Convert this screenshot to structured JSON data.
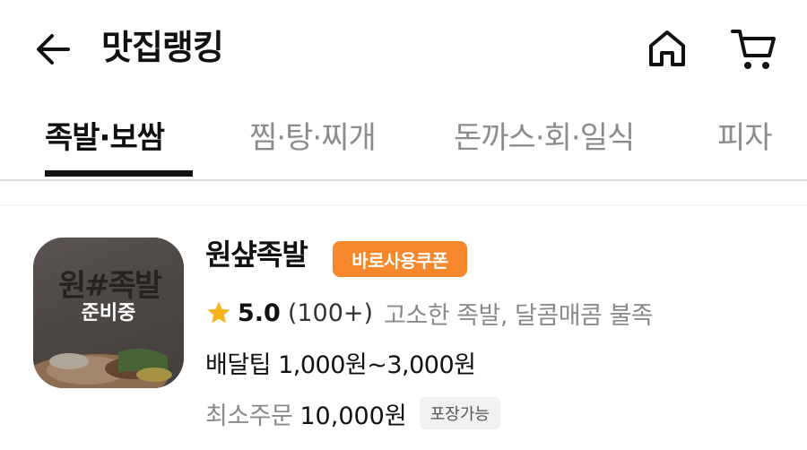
{
  "header": {
    "title": "맛집랭킹",
    "icons": {
      "back": "arrow-left-icon",
      "home": "home-icon",
      "cart": "cart-icon"
    }
  },
  "tabs": [
    {
      "label": "족발·보쌈",
      "active": true
    },
    {
      "label": "찜·탕·찌개",
      "active": false
    },
    {
      "label": "돈까스·회·일식",
      "active": false
    },
    {
      "label": "피자",
      "active": false
    }
  ],
  "store": {
    "name": "원샾족발",
    "coupon_badge": "바로사용쿠폰",
    "thumbnail_logo": "원#족발",
    "status": "준비중",
    "rating": "5.0",
    "review_count": "(100+)",
    "tagline": "고소한 족발, 달콤매콤 불족",
    "delivery_fee": "배달팁 1,000원~3,000원",
    "min_order_label": "최소주문",
    "min_order_value": "10,000원",
    "pickup_badge": "포장가능"
  },
  "colors": {
    "accent": "#f5872c",
    "star": "#f6b21b",
    "text_primary": "#111111",
    "text_secondary": "#8a8a8a"
  }
}
